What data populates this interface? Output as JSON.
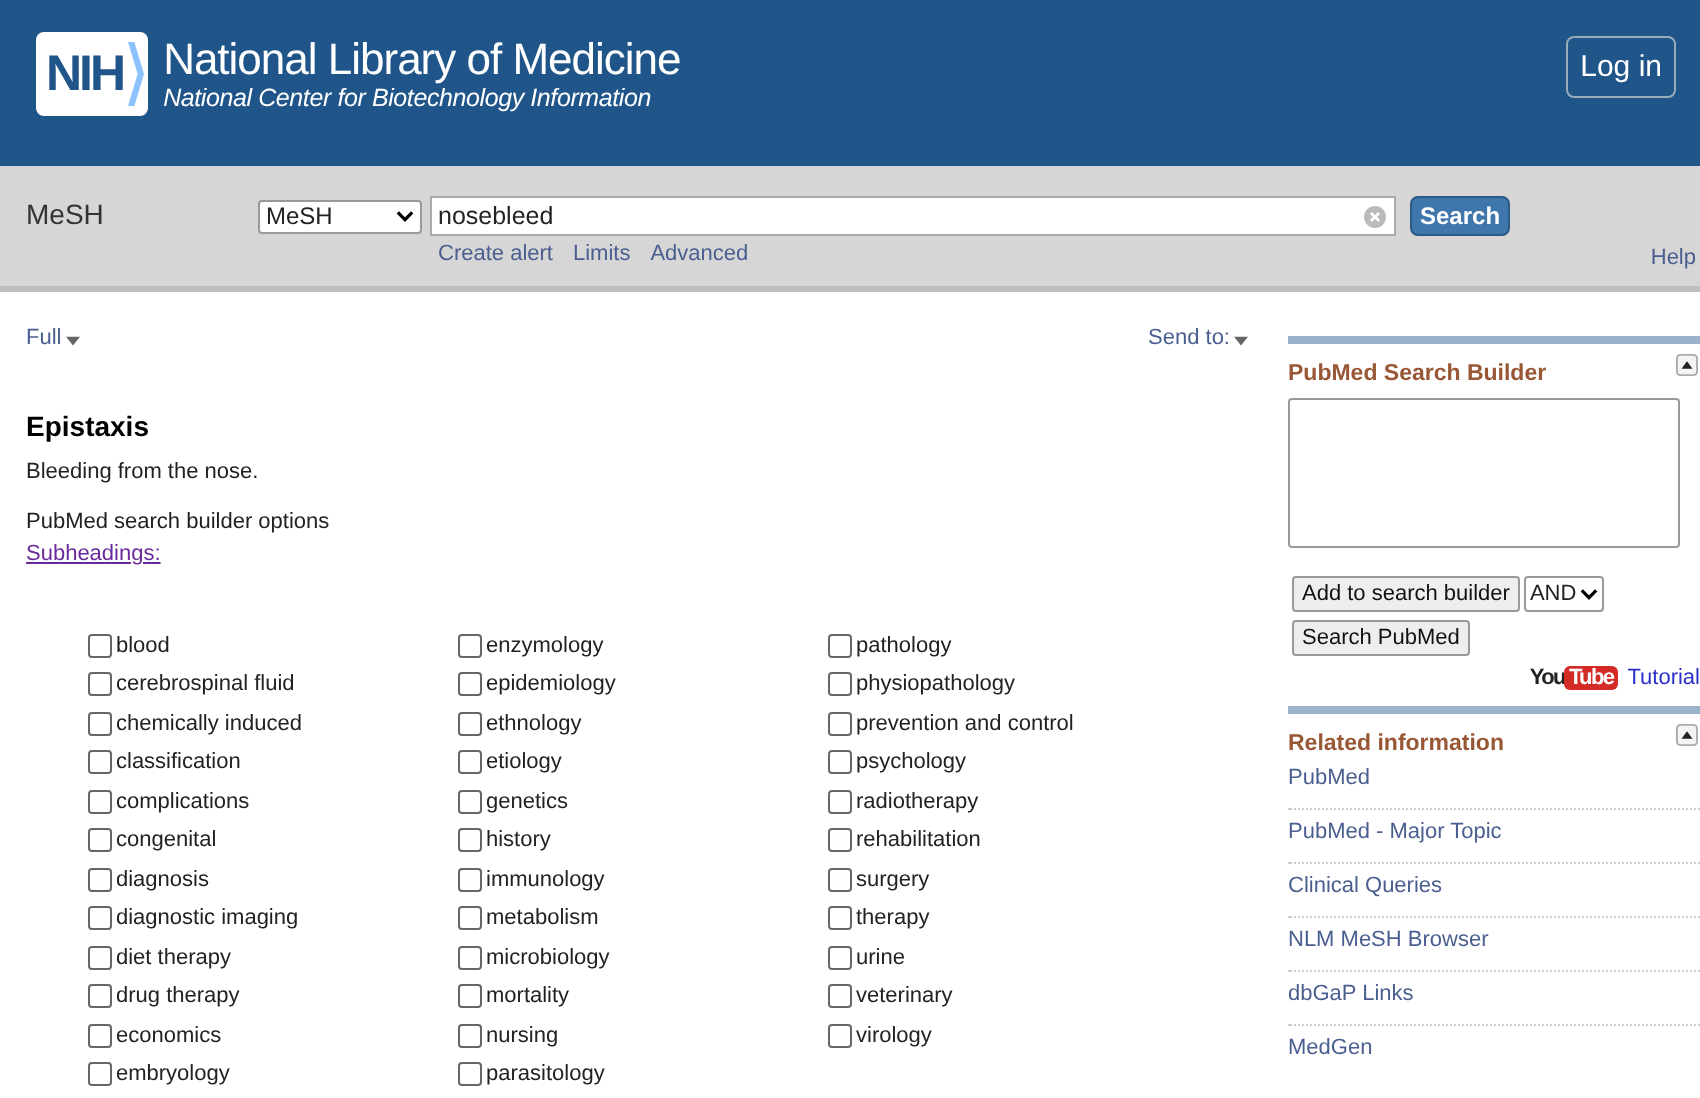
{
  "header": {
    "logo": "NIH",
    "title": "National Library of Medicine",
    "subtitle": "National Center for Biotechnology Information",
    "login": "Log in"
  },
  "searchbar": {
    "database_label": "MeSH",
    "database": "MeSH",
    "query": "nosebleed",
    "search": "Search",
    "links": [
      "Create alert",
      "Limits",
      "Advanced"
    ],
    "help": "Help"
  },
  "toolbar": {
    "format": "Full",
    "send_to": "Send to:"
  },
  "record": {
    "title": "Epistaxis",
    "definition": "Bleeding from the nose.",
    "options_label": "PubMed search builder options",
    "subheadings_link": "Subheadings:"
  },
  "subheadings": [
    [
      {
        "label": "blood",
        "checked": false
      },
      {
        "label": "cerebrospinal fluid",
        "checked": false
      },
      {
        "label": "chemically induced",
        "checked": false
      },
      {
        "label": "classification",
        "checked": false
      },
      {
        "label": "complications",
        "checked": false
      },
      {
        "label": "congenital",
        "checked": false
      },
      {
        "label": "diagnosis",
        "checked": false
      },
      {
        "label": "diagnostic imaging",
        "checked": false
      },
      {
        "label": "diet therapy",
        "checked": false
      },
      {
        "label": "drug therapy",
        "checked": false
      },
      {
        "label": "economics",
        "checked": false
      },
      {
        "label": "embryology",
        "checked": false
      }
    ],
    [
      {
        "label": "enzymology",
        "checked": false
      },
      {
        "label": "epidemiology",
        "checked": false
      },
      {
        "label": "ethnology",
        "checked": false
      },
      {
        "label": "etiology",
        "checked": false
      },
      {
        "label": "genetics",
        "checked": false
      },
      {
        "label": "history",
        "checked": false
      },
      {
        "label": "immunology",
        "checked": false
      },
      {
        "label": "metabolism",
        "checked": false
      },
      {
        "label": "microbiology",
        "checked": false
      },
      {
        "label": "mortality",
        "checked": false
      },
      {
        "label": "nursing",
        "checked": false
      },
      {
        "label": "parasitology",
        "checked": false
      }
    ],
    [
      {
        "label": "pathology",
        "checked": false
      },
      {
        "label": "physiopathology",
        "checked": false
      },
      {
        "label": "prevention and control",
        "checked": false
      },
      {
        "label": "psychology",
        "checked": false
      },
      {
        "label": "radiotherapy",
        "checked": false
      },
      {
        "label": "rehabilitation",
        "checked": false
      },
      {
        "label": "surgery",
        "checked": false
      },
      {
        "label": "therapy",
        "checked": false
      },
      {
        "label": "urine",
        "checked": false
      },
      {
        "label": "veterinary",
        "checked": false
      },
      {
        "label": "virology",
        "checked": false
      }
    ]
  ],
  "builder": {
    "title": "PubMed Search Builder",
    "add": "Add to search builder",
    "operator": "AND",
    "search": "Search PubMed",
    "youtube_you": "You",
    "youtube_tube": "Tube",
    "tutorial": "Tutorial"
  },
  "related": {
    "title": "Related information",
    "items": [
      "PubMed",
      "PubMed - Major Topic",
      "Clinical Queries",
      "NLM MeSH Browser",
      "dbGaP Links",
      "MedGen"
    ]
  }
}
